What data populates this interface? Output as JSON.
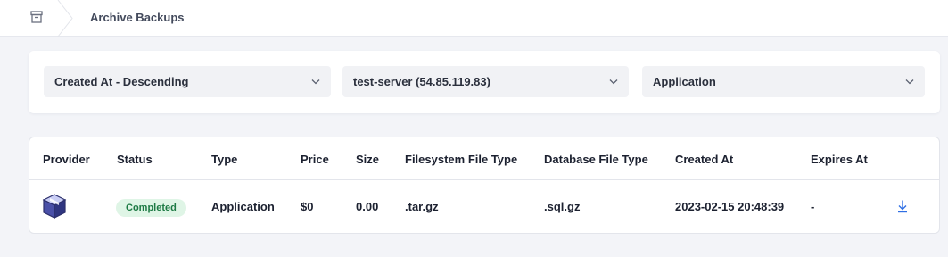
{
  "header": {
    "home_icon": "archive-box-icon",
    "breadcrumb_title": "Archive Backups"
  },
  "filters": {
    "sort": {
      "value": "Created At - Descending",
      "icon": "chevron-down-icon"
    },
    "server": {
      "value": "test-server (54.85.119.83)",
      "icon": "chevron-down-icon"
    },
    "type": {
      "value": "Application",
      "icon": "chevron-down-icon"
    }
  },
  "table": {
    "columns": [
      "Provider",
      "Status",
      "Type",
      "Price",
      "Size",
      "Filesystem File Type",
      "Database File Type",
      "Created At",
      "Expires At"
    ],
    "rows": [
      {
        "provider_icon": "provider-box-icon",
        "status": "Completed",
        "type": "Application",
        "price": "$0",
        "size": "0.00",
        "filesystem_file_type": ".tar.gz",
        "database_file_type": ".sql.gz",
        "created_at": "2023-02-15 20:48:39",
        "expires_at": "-",
        "action_icon": "download-icon"
      }
    ]
  },
  "colors": {
    "accent": "#2f6fe4",
    "status_completed_bg": "#dff5e6",
    "status_completed_text": "#1d7a44"
  }
}
